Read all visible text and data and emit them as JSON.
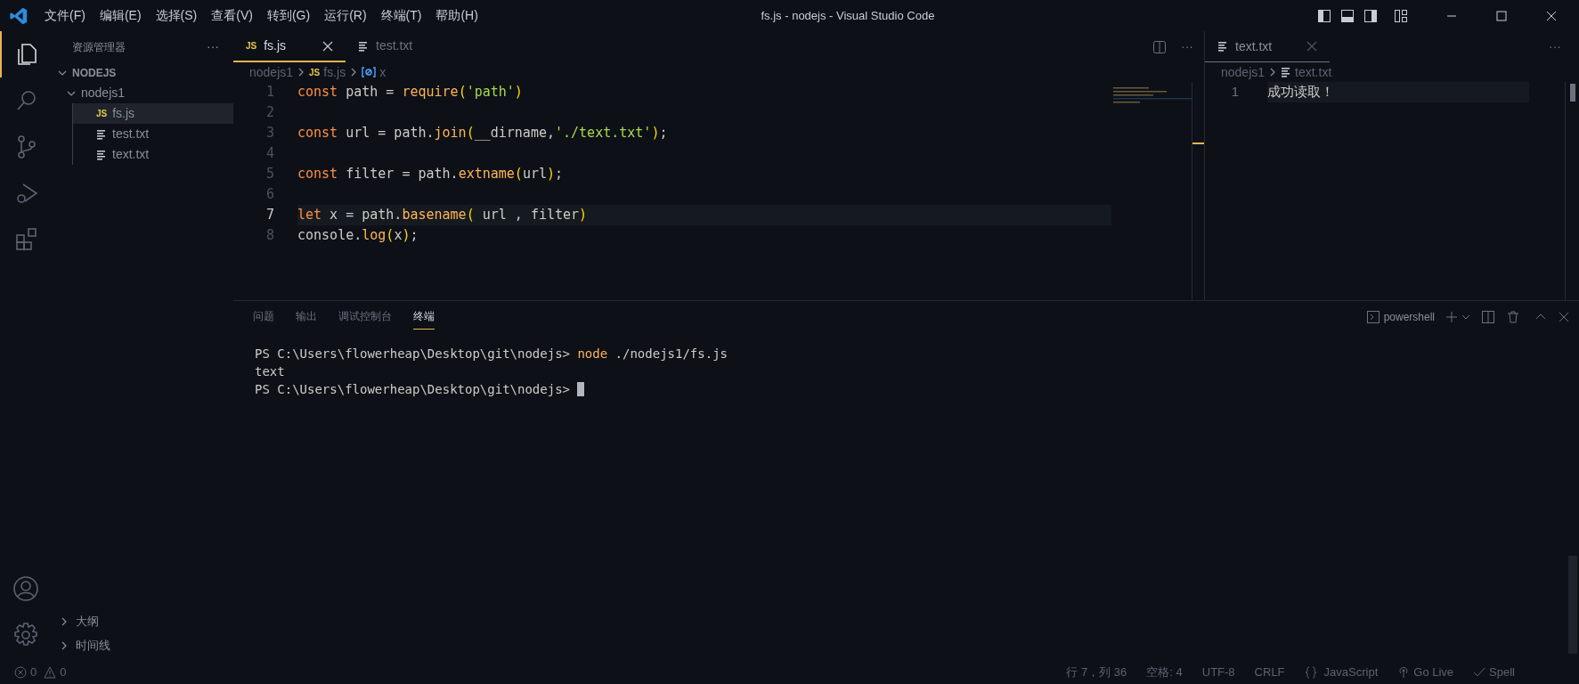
{
  "window": {
    "title": "fs.js - nodejs - Visual Studio Code"
  },
  "menu": [
    "文件(F)",
    "编辑(E)",
    "选择(S)",
    "查看(V)",
    "转到(G)",
    "运行(R)",
    "终端(T)",
    "帮助(H)"
  ],
  "activity_bar": [
    {
      "kind": "files",
      "selected": true
    },
    {
      "kind": "search",
      "selected": false
    },
    {
      "kind": "scm",
      "selected": false
    },
    {
      "kind": "debug",
      "selected": false
    },
    {
      "kind": "extensions",
      "selected": false
    }
  ],
  "sidebar": {
    "title": "资源管理器",
    "more": "···",
    "root": {
      "label": "NODEJS",
      "expanded": true,
      "children": [
        {
          "label": "nodejs1",
          "expanded": true,
          "selected": false,
          "children": [
            {
              "label": "fs.js",
              "kind": "js",
              "icon": "JS",
              "selected": true
            },
            {
              "label": "test.txt",
              "kind": "txt",
              "selected": false
            },
            {
              "label": "text.txt",
              "kind": "txt",
              "selected": false
            }
          ]
        }
      ]
    },
    "sections": [
      {
        "label": "大纲",
        "expanded": false
      },
      {
        "label": "时间线",
        "expanded": false
      }
    ]
  },
  "editor_left": {
    "tabs": [
      {
        "label": "fs.js",
        "kind": "js",
        "icon": "JS",
        "selected": true
      },
      {
        "label": "test.txt",
        "kind": "txt",
        "selected": false
      }
    ],
    "more": "···",
    "breadcrumb": [
      {
        "label": "nodejs1",
        "kind": "folder"
      },
      {
        "label": "fs.js",
        "kind": "js",
        "icon": "JS"
      },
      {
        "label": "x",
        "kind": "symbol"
      }
    ],
    "lines": [
      {
        "number": "1",
        "current": false,
        "tokens": [
          {
            "t": "const",
            "kind": "kw"
          },
          {
            "t": " path = ",
            "kind": "id"
          },
          {
            "t": "require",
            "kind": "fn"
          },
          {
            "t": "(",
            "kind": "br"
          },
          {
            "t": "'path'",
            "kind": "str"
          },
          {
            "t": ")",
            "kind": "br"
          }
        ]
      },
      {
        "number": "2",
        "current": false
      },
      {
        "number": "3",
        "current": false,
        "tokens": [
          {
            "t": "const",
            "kind": "kw"
          },
          {
            "t": " url = path.",
            "kind": "id"
          },
          {
            "t": "join",
            "kind": "fn"
          },
          {
            "t": "(",
            "kind": "br"
          },
          {
            "t": "__dirname,",
            "kind": "id"
          },
          {
            "t": "'./text.txt'",
            "kind": "str"
          },
          {
            "t": ")",
            "kind": "br"
          },
          {
            "t": ";",
            "kind": "id"
          }
        ]
      },
      {
        "number": "4",
        "current": false
      },
      {
        "number": "5",
        "current": false,
        "tokens": [
          {
            "t": "const",
            "kind": "kw"
          },
          {
            "t": " filter = path.",
            "kind": "id"
          },
          {
            "t": "extname",
            "kind": "fn"
          },
          {
            "t": "(",
            "kind": "br"
          },
          {
            "t": "url",
            "kind": "id"
          },
          {
            "t": ")",
            "kind": "br"
          },
          {
            "t": ";",
            "kind": "id"
          }
        ]
      },
      {
        "number": "6",
        "current": false
      },
      {
        "number": "7",
        "current": true,
        "tokens": [
          {
            "t": "let",
            "kind": "kw"
          },
          {
            "t": " x = path.",
            "kind": "id"
          },
          {
            "t": "basename",
            "kind": "fn"
          },
          {
            "t": "(",
            "kind": "br"
          },
          {
            "t": " url , filter",
            "kind": "id"
          },
          {
            "t": ")",
            "kind": "br"
          }
        ]
      },
      {
        "number": "8",
        "current": false,
        "tokens": [
          {
            "t": "console.",
            "kind": "id"
          },
          {
            "t": "log",
            "kind": "fn"
          },
          {
            "t": "(",
            "kind": "br"
          },
          {
            "t": "x",
            "kind": "id"
          },
          {
            "t": ")",
            "kind": "br"
          },
          {
            "t": ";",
            "kind": "id"
          }
        ]
      }
    ]
  },
  "editor_right": {
    "tabs": [
      {
        "label": "text.txt",
        "kind": "txt",
        "selected": true
      }
    ],
    "more": "···",
    "breadcrumb": [
      {
        "label": "nodejs1",
        "kind": "folder"
      },
      {
        "label": "text.txt",
        "kind": "txt"
      }
    ],
    "lines": [
      {
        "number": "1",
        "text": "成功读取！"
      }
    ]
  },
  "panel": {
    "tabs": [
      {
        "label": "问题",
        "selected": false
      },
      {
        "label": "输出",
        "selected": false
      },
      {
        "label": "调试控制台",
        "selected": false
      },
      {
        "label": "终端",
        "selected": true
      }
    ],
    "shell": "powershell",
    "terminal": [
      {
        "prompt": "PS C:\\Users\\flowerheap\\Desktop\\git\\nodejs> ",
        "command": "node",
        "args": " ./nodejs1/fs.js"
      },
      {
        "output": "text"
      },
      {
        "prompt": "PS C:\\Users\\flowerheap\\Desktop\\git\\nodejs> ",
        "cursor": true
      }
    ]
  },
  "status_bar": {
    "errors": "0",
    "warnings": "0",
    "items": [
      "行 7，列 36",
      "空格: 4",
      "UTF-8",
      "CRLF"
    ],
    "language": "JavaScript",
    "golive": "Go Live",
    "spell": "Spell"
  }
}
